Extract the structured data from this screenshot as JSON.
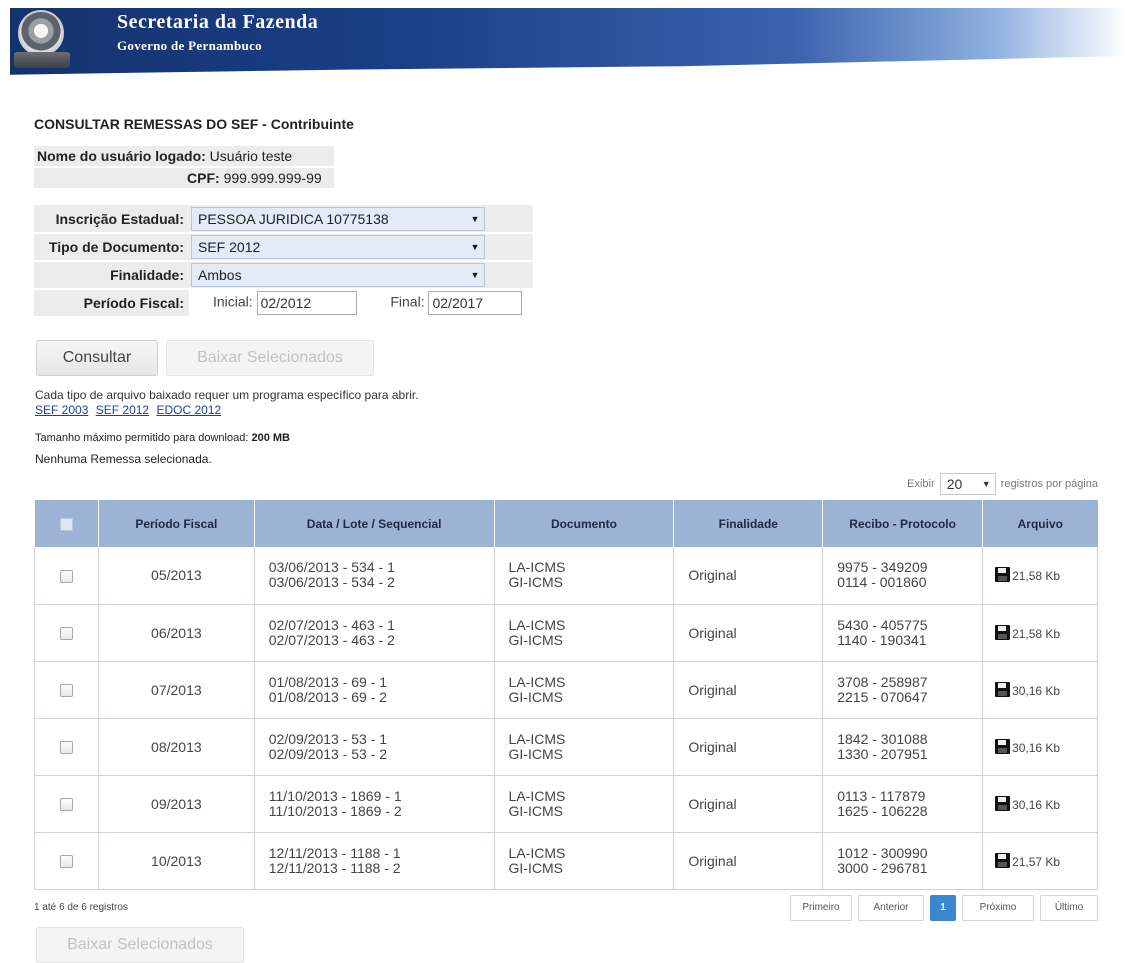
{
  "header": {
    "title": "Secretaria da Fazenda",
    "subtitle": "Governo de Pernambuco"
  },
  "page": {
    "title": "CONSULTAR REMESSAS DO SEF - Contribuinte"
  },
  "user": {
    "name_label": "Nome do usuário logado:",
    "name_value": "Usuário teste",
    "cpf_label": "CPF:",
    "cpf_value": "999.999.999-99"
  },
  "form": {
    "inscricao_label": "Inscrição Estadual:",
    "inscricao_value": "PESSOA JURIDICA 10775138",
    "tipo_label": "Tipo de Documento:",
    "tipo_value": "SEF 2012",
    "finalidade_label": "Finalidade:",
    "finalidade_value": "Ambos",
    "periodo_label": "Período Fiscal:",
    "inicial_label": "Inicial:",
    "inicial_value": "02/2012",
    "final_label": "Final:",
    "final_value": "02/2017"
  },
  "buttons": {
    "consultar": "Consultar",
    "baixar_selecionados": "Baixar Selecionados"
  },
  "info": {
    "programa_text": "Cada tipo de arquivo baixado requer um programa específico para abrir.",
    "links": [
      "SEF 2003",
      "SEF 2012",
      "EDOC 2012"
    ],
    "maxsize_text": "Tamanho máximo permitido para download:",
    "maxsize_value": "200 MB",
    "nenhuma": "Nenhuma Remessa selecionada."
  },
  "paging": {
    "exibir_label": "Exibir",
    "per_page": "20",
    "per_page_suffix": "registros por página",
    "count_text": "1 até 6 de 6 registros",
    "first": "Primeiro",
    "prev": "Anterior",
    "current": "1",
    "next": "Próximo",
    "last": "Último"
  },
  "table": {
    "headers": [
      "Período Fiscal",
      "Data / Lote / Sequencial",
      "Documento",
      "Finalidade",
      "Recibo - Protocolo",
      "Arquivo"
    ],
    "rows": [
      {
        "periodo": "05/2013",
        "data1": "03/06/2013 - 534 - 1",
        "data2": "03/06/2013 - 534 - 2",
        "doc1": "LA-ICMS",
        "doc2": "GI-ICMS",
        "finalidade": "Original",
        "recibo1": "9975 - 349209",
        "recibo2": "0114 - 001860",
        "arquivo": "21,58 Kb"
      },
      {
        "periodo": "06/2013",
        "data1": "02/07/2013 - 463 - 1",
        "data2": "02/07/2013 - 463 - 2",
        "doc1": "LA-ICMS",
        "doc2": "GI-ICMS",
        "finalidade": "Original",
        "recibo1": "5430 - 405775",
        "recibo2": "1140 - 190341",
        "arquivo": "21,58 Kb"
      },
      {
        "periodo": "07/2013",
        "data1": "01/08/2013 - 69 - 1",
        "data2": "01/08/2013 - 69 - 2",
        "doc1": "LA-ICMS",
        "doc2": "GI-ICMS",
        "finalidade": "Original",
        "recibo1": "3708 - 258987",
        "recibo2": "2215 - 070647",
        "arquivo": "30,16 Kb"
      },
      {
        "periodo": "08/2013",
        "data1": "02/09/2013 - 53 - 1",
        "data2": "02/09/2013 - 53 - 2",
        "doc1": "LA-ICMS",
        "doc2": "GI-ICMS",
        "finalidade": "Original",
        "recibo1": "1842 - 301088",
        "recibo2": "1330 - 207951",
        "arquivo": "30,16 Kb"
      },
      {
        "periodo": "09/2013",
        "data1": "11/10/2013 - 1869 - 1",
        "data2": "11/10/2013 - 1869 - 2",
        "doc1": "LA-ICMS",
        "doc2": "GI-ICMS",
        "finalidade": "Original",
        "recibo1": "0113 - 117879",
        "recibo2": "1625 - 106228",
        "arquivo": "30,16 Kb"
      },
      {
        "periodo": "10/2013",
        "data1": "12/11/2013 - 1188 - 1",
        "data2": "12/11/2013 - 1188 - 2",
        "doc1": "LA-ICMS",
        "doc2": "GI-ICMS",
        "finalidade": "Original",
        "recibo1": "1012 - 300990",
        "recibo2": "3000 - 296781",
        "arquivo": "21,57 Kb"
      }
    ]
  }
}
